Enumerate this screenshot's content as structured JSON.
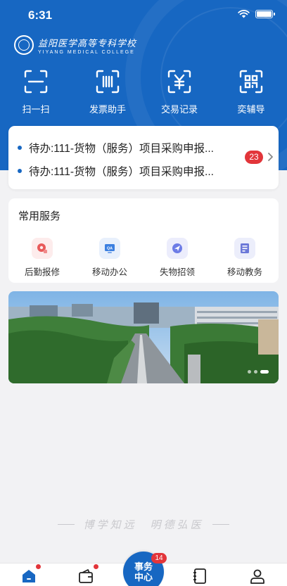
{
  "status_bar": {
    "time": "6:31"
  },
  "brand": {
    "name_cn": "益阳医学高等专科学校",
    "name_en": "YIYANG MEDICAL COLLEGE",
    "logo_icon": "college-seal-icon"
  },
  "quick_actions": [
    {
      "label": "扫一扫",
      "icon": "scan-icon"
    },
    {
      "label": "发票助手",
      "icon": "invoice-icon"
    },
    {
      "label": "交易记录",
      "icon": "yuan-transaction-icon"
    },
    {
      "label": "奕辅导",
      "icon": "qr-code-icon"
    }
  ],
  "todo": {
    "items": [
      {
        "text": "待办:111-货物（服务）项目采购申报..."
      },
      {
        "text": "待办:111-货物（服务）项目采购申报..."
      }
    ],
    "badge": "23",
    "chevron_icon": "chevron-right-icon"
  },
  "services": {
    "title": "常用服务",
    "items": [
      {
        "label": "后勤报修",
        "icon": "repair-icon",
        "color": "#e85a5a",
        "bg": "#fdecec"
      },
      {
        "label": "移动办公",
        "icon": "qa-monitor-icon",
        "color": "#3b7fe0",
        "bg": "#e8f0fc"
      },
      {
        "label": "失物招领",
        "icon": "lost-found-icon",
        "color": "#6d7ce6",
        "bg": "#ecedfc"
      },
      {
        "label": "移动教务",
        "icon": "academic-doc-icon",
        "color": "#6b78d8",
        "bg": "#eceefb"
      }
    ]
  },
  "banner": {
    "slides": 3,
    "active_slide": 3
  },
  "slogan": "博学知远　明德弘医",
  "tabbar": {
    "center_line1": "事务",
    "center_line2": "中心",
    "center_badge": "14",
    "tabs": [
      {
        "icon": "home-icon",
        "dot": true
      },
      {
        "icon": "wallet-icon",
        "dot": true
      },
      {
        "icon": "contacts-book-icon",
        "dot": false
      },
      {
        "icon": "profile-icon",
        "dot": false
      }
    ]
  },
  "colors": {
    "primary": "#1767c2",
    "badge_red": "#e2353a",
    "page_bg": "#f2f2f4"
  }
}
